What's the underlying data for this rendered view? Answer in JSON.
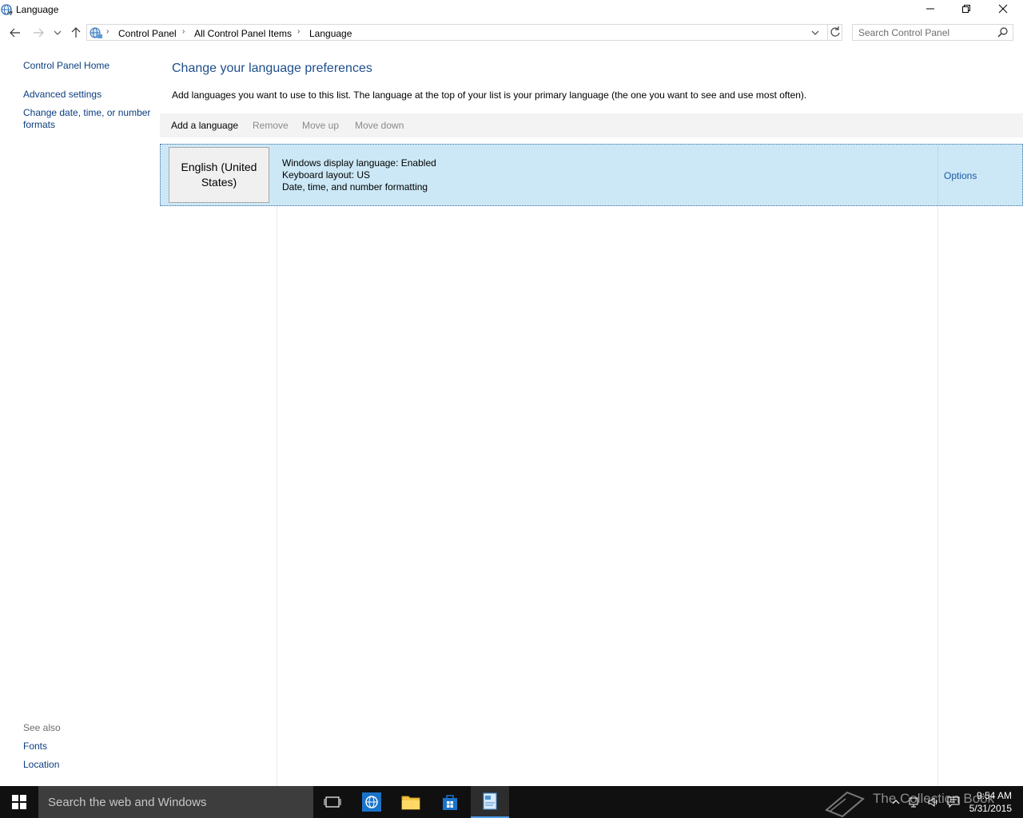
{
  "window": {
    "title": "Language"
  },
  "address": {
    "crumbs": [
      "Control Panel",
      "All Control Panel Items",
      "Language"
    ]
  },
  "search": {
    "placeholder": "Search Control Panel"
  },
  "left_pane": {
    "home": "Control Panel Home",
    "links": [
      "Advanced settings",
      "Change date, time, or number formats"
    ],
    "see_also_label": "See also",
    "see_also": [
      "Fonts",
      "Location"
    ]
  },
  "main": {
    "heading": "Change your language preferences",
    "description": "Add languages you want to use to this list. The language at the top of your list is your primary language (the one you want to see and use most often).",
    "toolbar": {
      "add": "Add a language",
      "remove": "Remove",
      "move_up": "Move up",
      "move_down": "Move down"
    },
    "languages": [
      {
        "name": "English (United States)",
        "details": [
          "Windows display language: Enabled",
          "Keyboard layout: US",
          "Date, time, and number formatting"
        ],
        "options_label": "Options"
      }
    ]
  },
  "taskbar": {
    "search_placeholder": "Search the web and Windows",
    "watermark": "The Collection Book",
    "time": "9:54 AM",
    "date": "5/31/2015"
  },
  "colors": {
    "selected_row": "#cce8f6",
    "link": "#0b3d7f",
    "heading": "#1e4e8c",
    "taskbar": "#101010"
  }
}
